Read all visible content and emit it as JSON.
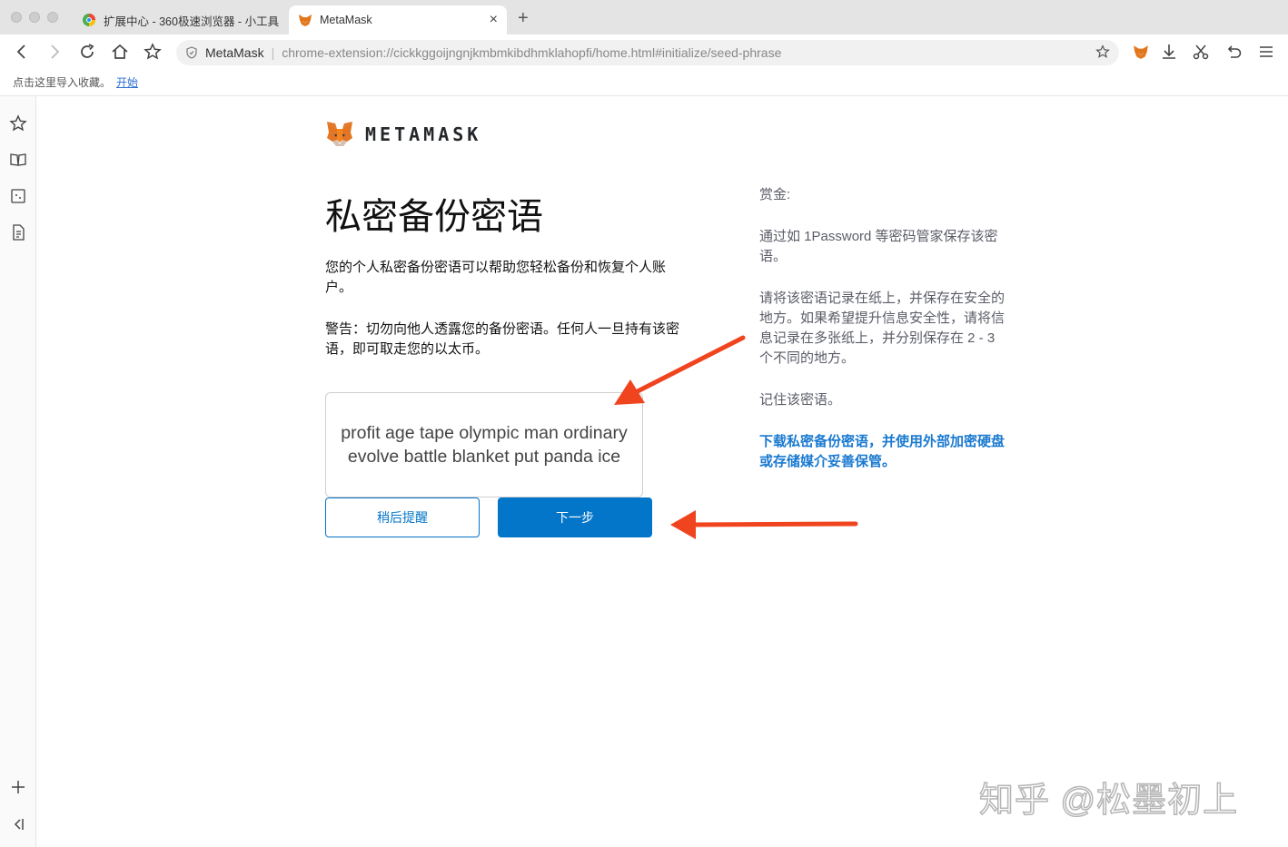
{
  "tabs": [
    {
      "title": "扩展中心 - 360极速浏览器 - 小工具",
      "active": false
    },
    {
      "title": "MetaMask",
      "active": true
    }
  ],
  "omnibox": {
    "site": "MetaMask",
    "url": "chrome-extension://cickkggoijngnjkmbmkibdhmklahopfi/home.html#initialize/seed-phrase"
  },
  "bookmarkbar": {
    "hint": "点击这里导入收藏。",
    "link": "开始"
  },
  "logo": {
    "text": "METAMASK"
  },
  "main": {
    "title": "私密备份密语",
    "description": "您的个人私密备份密语可以帮助您轻松备份和恢复个人账户。",
    "warning": "警告：切勿向他人透露您的备份密语。任何人一旦持有该密语，即可取走您的以太币。",
    "seed_phrase": "profit age tape olympic man ordinary evolve battle blanket put panda ice",
    "later_button": "稍后提醒",
    "next_button": "下一步"
  },
  "tips": {
    "heading": "赏金:",
    "tip1": "通过如 1Password 等密码管家保存该密语。",
    "tip2": "请将该密语记录在纸上，并保存在安全的地方。如果希望提升信息安全性，请将信息记录在多张纸上，并分别保存在 2 - 3 个不同的地方。",
    "tip3": "记住该密语。",
    "download_link": "下载私密备份密语，并使用外部加密硬盘或存储媒介妥善保管。"
  },
  "watermark": "知乎 @松墨初上",
  "colors": {
    "accent": "#0376c9",
    "annotation_arrow": "#f0441f"
  }
}
